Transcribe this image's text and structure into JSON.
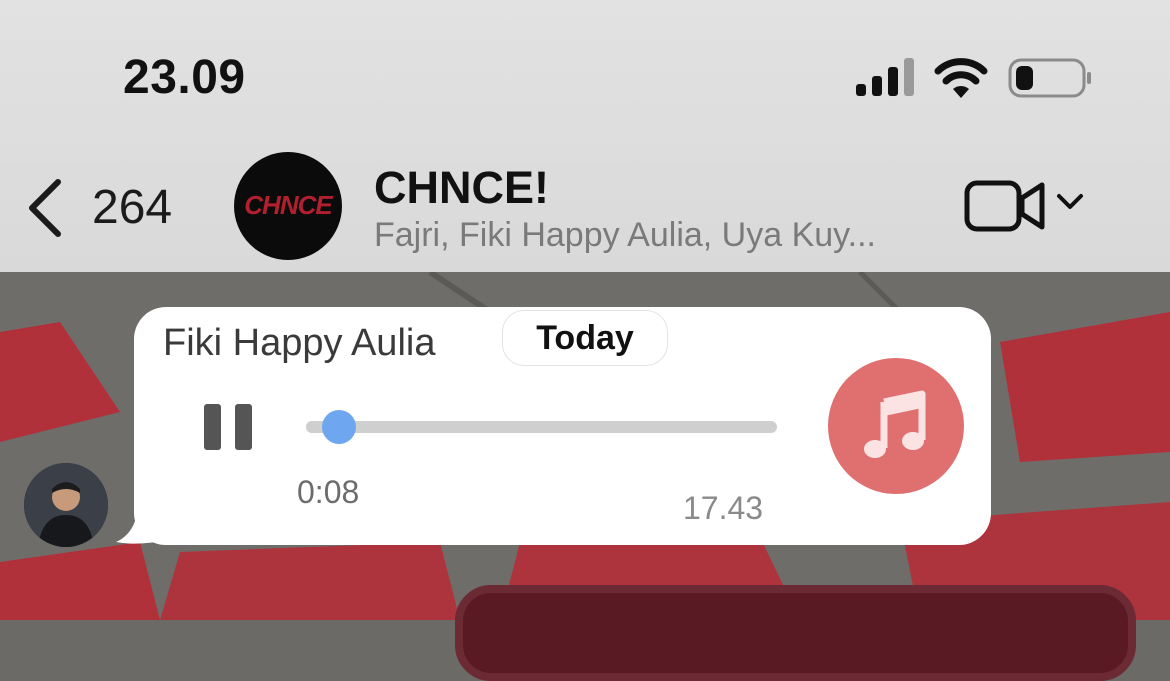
{
  "status_bar": {
    "time": "23.09",
    "icons": [
      "cellular-signal-icon",
      "wifi-icon",
      "battery-icon"
    ],
    "signal_bars": 3,
    "battery_level": 0.2
  },
  "header": {
    "back_count": "264",
    "group_name": "CHNCE!",
    "group_avatar_text": "CHNCE",
    "members_preview": "Fajri, Fiki Happy Aulia, Uya Kuy...",
    "video_icon": "video-camera-icon"
  },
  "date_separator": "Today",
  "message": {
    "sender": "Fiki Happy Aulia",
    "audio": {
      "state": "playing",
      "elapsed": "0:08",
      "progress": 0.07
    },
    "time": "17.43",
    "music_icon": "music-note-icon"
  },
  "colors": {
    "header_bg": "#dcdcdc",
    "knob": "#6ea6f0",
    "music_button": "#e07070",
    "wallpaper_red": "#b82a36",
    "wallpaper_gray": "#6f6d69"
  }
}
